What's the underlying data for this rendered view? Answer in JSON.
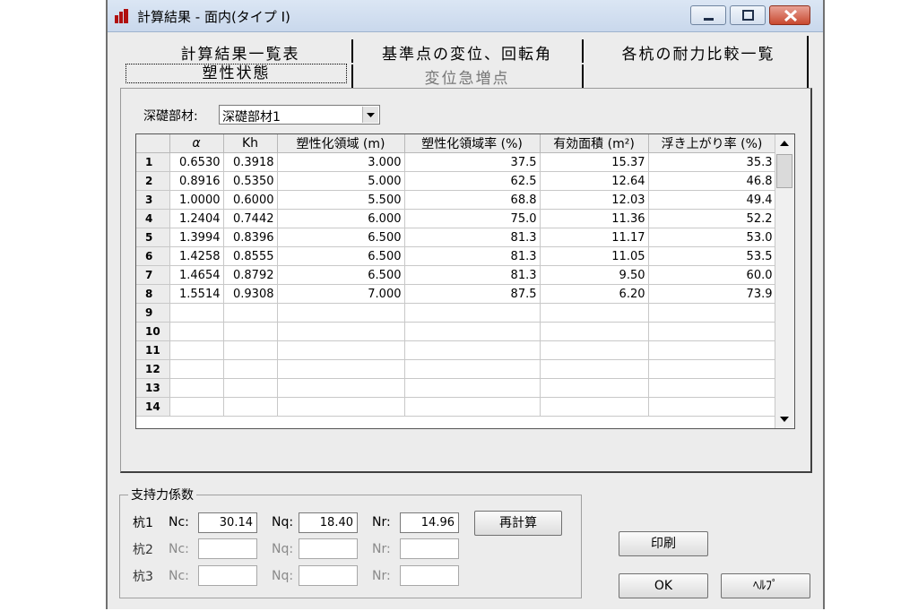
{
  "window": {
    "title": "計算結果 - 面内(タイプ I)"
  },
  "tabs": {
    "row1": [
      "計算結果一覧表",
      "基準点の変位、回転角",
      "各杭の耐力比較一覧"
    ],
    "row2": [
      "塑性状態",
      "変位急増点"
    ]
  },
  "member": {
    "label": "深礎部材:",
    "selected": "深礎部材1"
  },
  "table": {
    "columns": [
      "α",
      "Kh",
      "塑性化領域 (m)",
      "塑性化領域率 (%)",
      "有効面積 (m²)",
      "浮き上がり率 (%)"
    ],
    "rows": [
      [
        "1",
        "0.6530",
        "0.3918",
        "3.000",
        "37.5",
        "15.37",
        "35.3"
      ],
      [
        "2",
        "0.8916",
        "0.5350",
        "5.000",
        "62.5",
        "12.64",
        "46.8"
      ],
      [
        "3",
        "1.0000",
        "0.6000",
        "5.500",
        "68.8",
        "12.03",
        "49.4"
      ],
      [
        "4",
        "1.2404",
        "0.7442",
        "6.000",
        "75.0",
        "11.36",
        "52.2"
      ],
      [
        "5",
        "1.3994",
        "0.8396",
        "6.500",
        "81.3",
        "11.17",
        "53.0"
      ],
      [
        "6",
        "1.4258",
        "0.8555",
        "6.500",
        "81.3",
        "11.05",
        "53.5"
      ],
      [
        "7",
        "1.4654",
        "0.8792",
        "6.500",
        "81.3",
        "9.50",
        "60.0"
      ],
      [
        "8",
        "1.5514",
        "0.9308",
        "7.000",
        "87.5",
        "6.20",
        "73.9"
      ],
      [
        "9",
        "",
        "",
        "",
        "",
        "",
        ""
      ],
      [
        "10",
        "",
        "",
        "",
        "",
        "",
        ""
      ],
      [
        "11",
        "",
        "",
        "",
        "",
        "",
        ""
      ],
      [
        "12",
        "",
        "",
        "",
        "",
        "",
        ""
      ],
      [
        "13",
        "",
        "",
        "",
        "",
        "",
        ""
      ],
      [
        "14",
        "",
        "",
        "",
        "",
        "",
        ""
      ]
    ]
  },
  "bearing": {
    "title": "支持力係数",
    "piles": [
      {
        "label": "杭1",
        "nc_label": "Nc:",
        "nc": "30.14",
        "nq_label": "Nq:",
        "nq": "18.40",
        "nr_label": "Nr:",
        "nr": "14.96"
      },
      {
        "label": "杭2",
        "nc_label": "Nc:",
        "nc": "",
        "nq_label": "Nq:",
        "nq": "",
        "nr_label": "Nr:",
        "nr": ""
      },
      {
        "label": "杭3",
        "nc_label": "Nc:",
        "nc": "",
        "nq_label": "Nq:",
        "nq": "",
        "nr_label": "Nr:",
        "nr": ""
      }
    ],
    "recalc_label": "再計算"
  },
  "buttons": {
    "print": "印刷",
    "ok": "OK",
    "help": "ﾍﾙﾌﾟ"
  },
  "colors": {
    "close_button": "#c8492f",
    "app_icon": "#b01010"
  }
}
